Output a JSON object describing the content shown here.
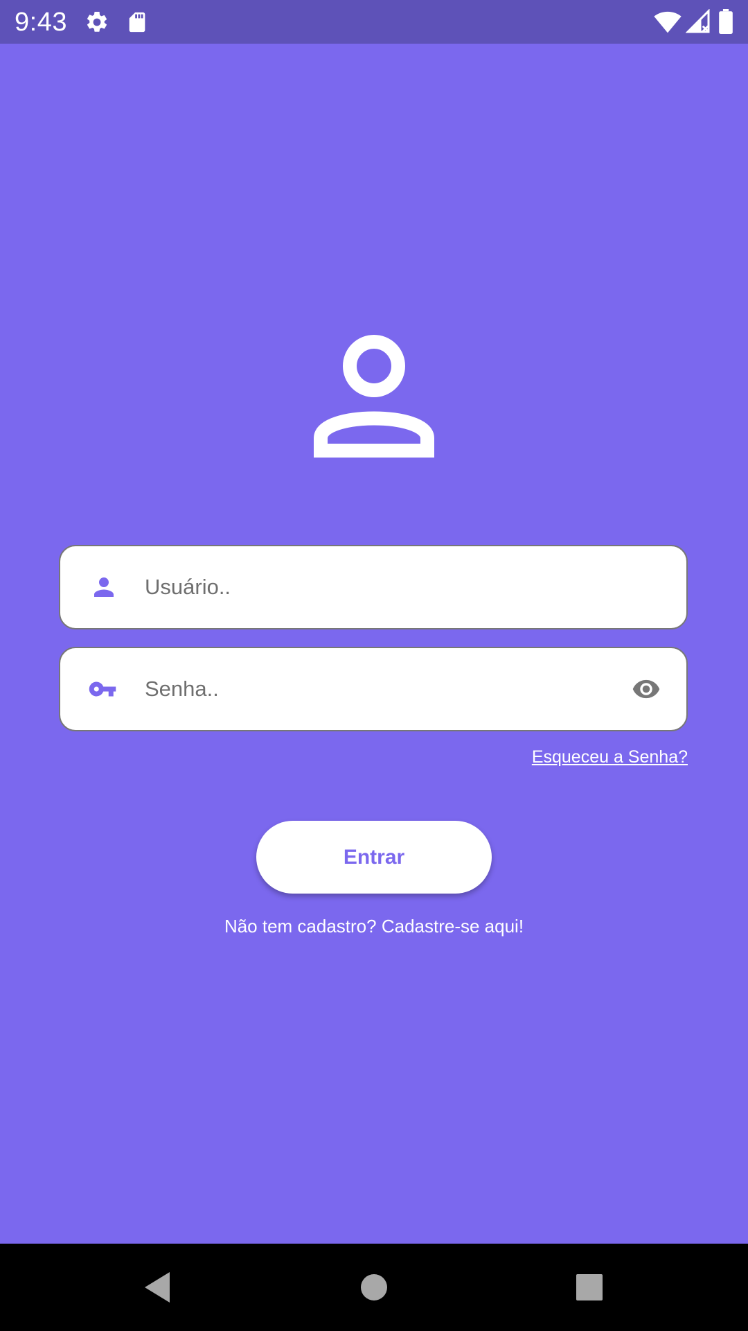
{
  "status_bar": {
    "time": "9:43",
    "icons": [
      "gear-icon",
      "sd-card-icon",
      "wifi-icon",
      "cell-signal-icon",
      "battery-icon"
    ]
  },
  "colors": {
    "background": "#7B68EE",
    "status_bar": "#5E52B8",
    "accent": "#7B68EE",
    "card": "#FFFFFF",
    "nav_bar": "#000000"
  },
  "login": {
    "header_icon": "person-outline-icon",
    "username": {
      "icon": "person-icon",
      "placeholder": "Usuário..",
      "value": ""
    },
    "password": {
      "icon": "key-icon",
      "placeholder": "Senha..",
      "value": "",
      "toggle_icon": "eye-icon"
    },
    "forgot_link": "Esqueceu a Senha?",
    "submit_label": "Entrar",
    "signup_text": "Não tem cadastro? Cadastre-se aqui!"
  },
  "nav_bar": {
    "buttons": [
      "back-icon",
      "home-icon",
      "recents-icon"
    ]
  }
}
